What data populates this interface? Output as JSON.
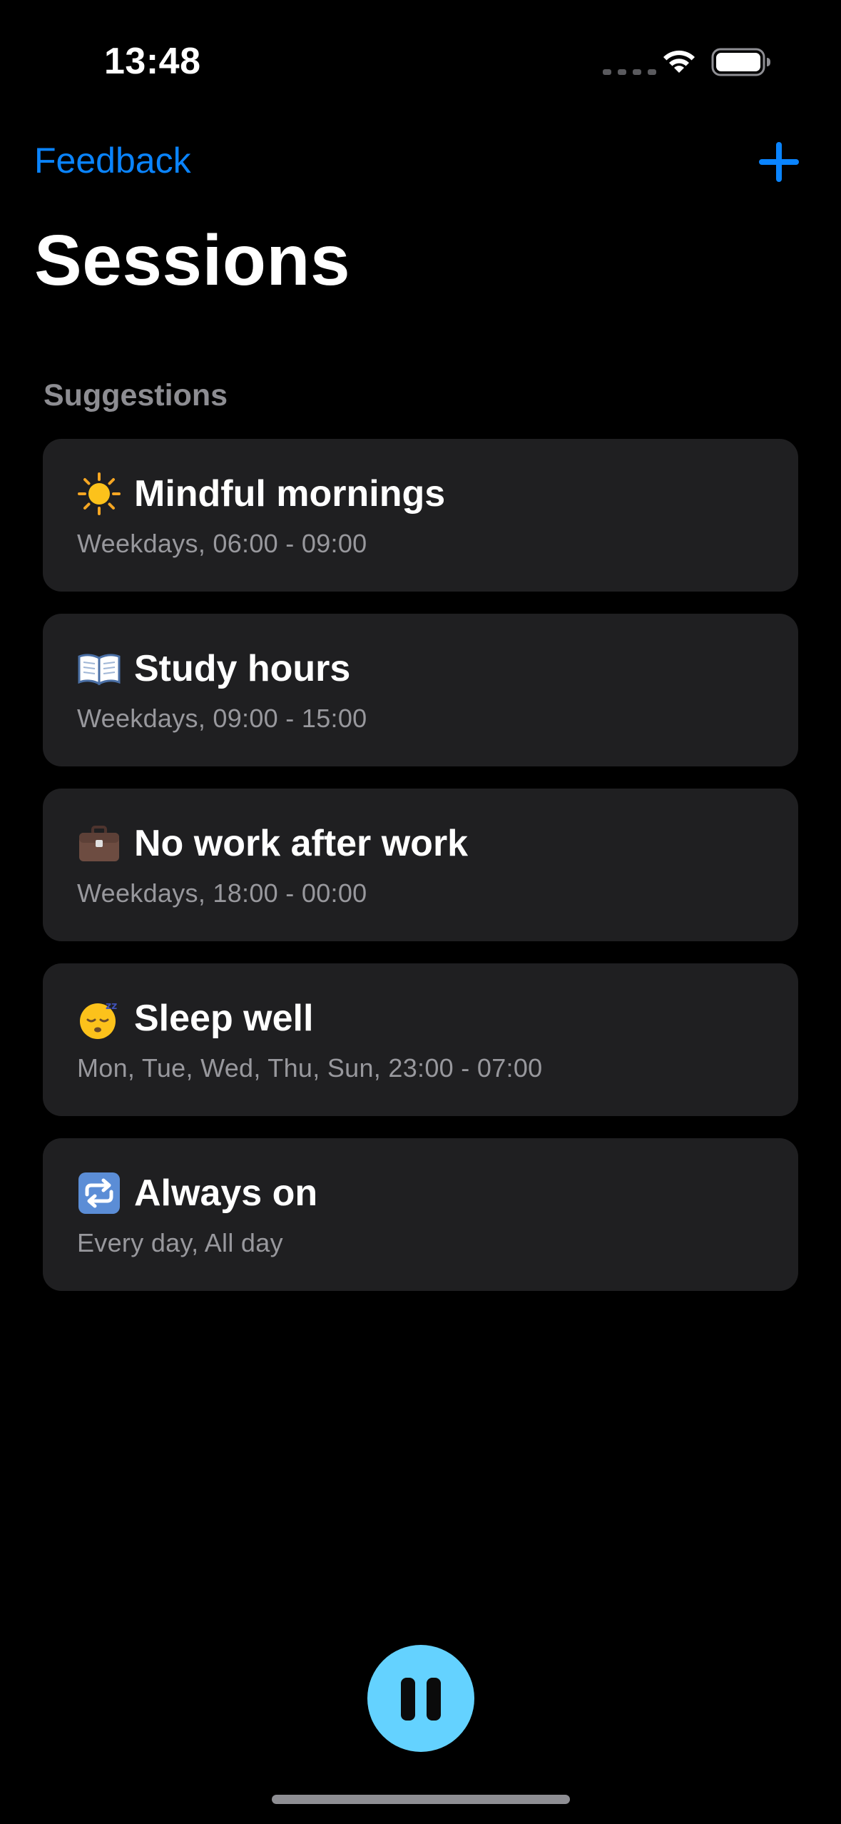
{
  "status_bar": {
    "time": "13:48",
    "icons": [
      "signal-dots-icon",
      "wifi-icon",
      "battery-icon"
    ]
  },
  "nav": {
    "feedback_label": "Feedback",
    "add_icon": "plus-icon"
  },
  "page": {
    "title": "Sessions",
    "section_label": "Suggestions"
  },
  "suggestions": [
    {
      "icon": "sun-icon",
      "title": "Mindful mornings",
      "schedule": "Weekdays, 06:00 - 09:00"
    },
    {
      "icon": "open-book-icon",
      "title": "Study hours",
      "schedule": "Weekdays, 09:00 - 15:00"
    },
    {
      "icon": "briefcase-icon",
      "title": "No work after work",
      "schedule": "Weekdays, 18:00 - 00:00"
    },
    {
      "icon": "sleeping-face-icon",
      "title": "Sleep well",
      "schedule": "Mon, Tue, Wed, Thu, Sun, 23:00 - 07:00"
    },
    {
      "icon": "repeat-icon",
      "title": "Always on",
      "schedule": "Every day, All day"
    }
  ],
  "controls": {
    "pause_icon": "pause-icon"
  },
  "colors": {
    "background": "#000000",
    "accent": "#0a84ff",
    "card": "#1f1f21",
    "secondary_text": "#98989d",
    "pause_button": "#64d2ff"
  }
}
